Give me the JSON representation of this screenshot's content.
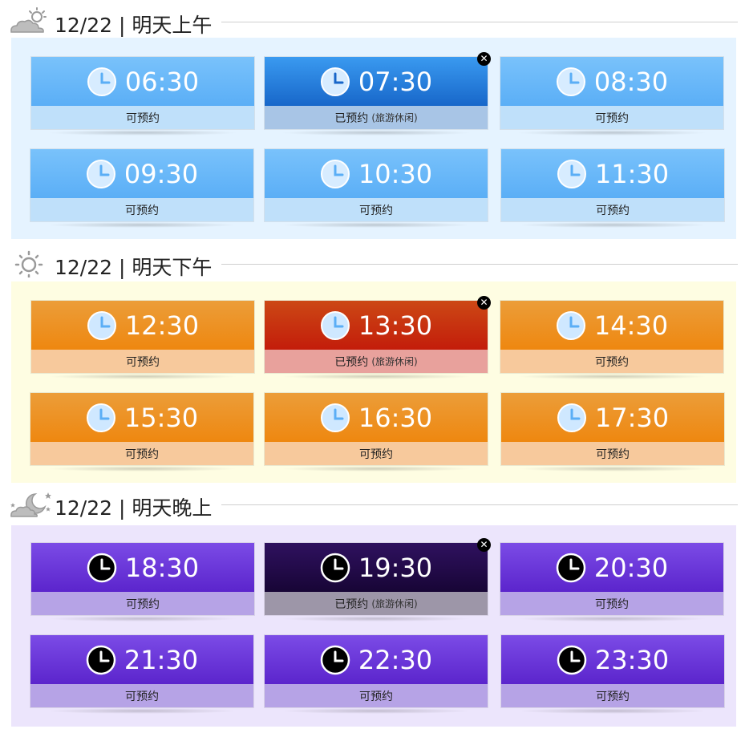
{
  "sections": [
    {
      "date": "12/22",
      "sep": "|",
      "period": "明天上午",
      "icon": "cloud-sun-icon",
      "slots": [
        {
          "time": "06:30",
          "status": "可预约",
          "note": ""
        },
        {
          "time": "07:30",
          "status": "已预约",
          "note": "(旅游休闲)"
        },
        {
          "time": "08:30",
          "status": "可预约",
          "note": ""
        },
        {
          "time": "09:30",
          "status": "可预约",
          "note": ""
        },
        {
          "time": "10:30",
          "status": "可预约",
          "note": ""
        },
        {
          "time": "11:30",
          "status": "可预约",
          "note": ""
        }
      ]
    },
    {
      "date": "12/22",
      "sep": "|",
      "period": "明天下午",
      "icon": "sun-icon",
      "slots": [
        {
          "time": "12:30",
          "status": "可预约",
          "note": ""
        },
        {
          "time": "13:30",
          "status": "已预约",
          "note": "(旅游休闲)"
        },
        {
          "time": "14:30",
          "status": "可预约",
          "note": ""
        },
        {
          "time": "15:30",
          "status": "可预约",
          "note": ""
        },
        {
          "time": "16:30",
          "status": "可预约",
          "note": ""
        },
        {
          "time": "17:30",
          "status": "可预约",
          "note": ""
        }
      ]
    },
    {
      "date": "12/22",
      "sep": "|",
      "period": "明天晚上",
      "icon": "cloud-moon-stars-icon",
      "slots": [
        {
          "time": "18:30",
          "status": "可预约",
          "note": ""
        },
        {
          "time": "19:30",
          "status": "已预约",
          "note": "(旅游休闲)"
        },
        {
          "time": "20:30",
          "status": "可预约",
          "note": ""
        },
        {
          "time": "21:30",
          "status": "可预约",
          "note": ""
        },
        {
          "time": "22:30",
          "status": "可预约",
          "note": ""
        },
        {
          "time": "23:30",
          "status": "可预约",
          "note": ""
        }
      ]
    }
  ],
  "close_symbol": "✕",
  "colors": {
    "morning_accent": "#5aaef6",
    "afternoon_accent": "#ee870f",
    "evening_accent": "#5b24cc",
    "morning_bg": "#e5f3ff",
    "afternoon_bg": "#fefde2",
    "evening_bg": "#ece5fc"
  }
}
